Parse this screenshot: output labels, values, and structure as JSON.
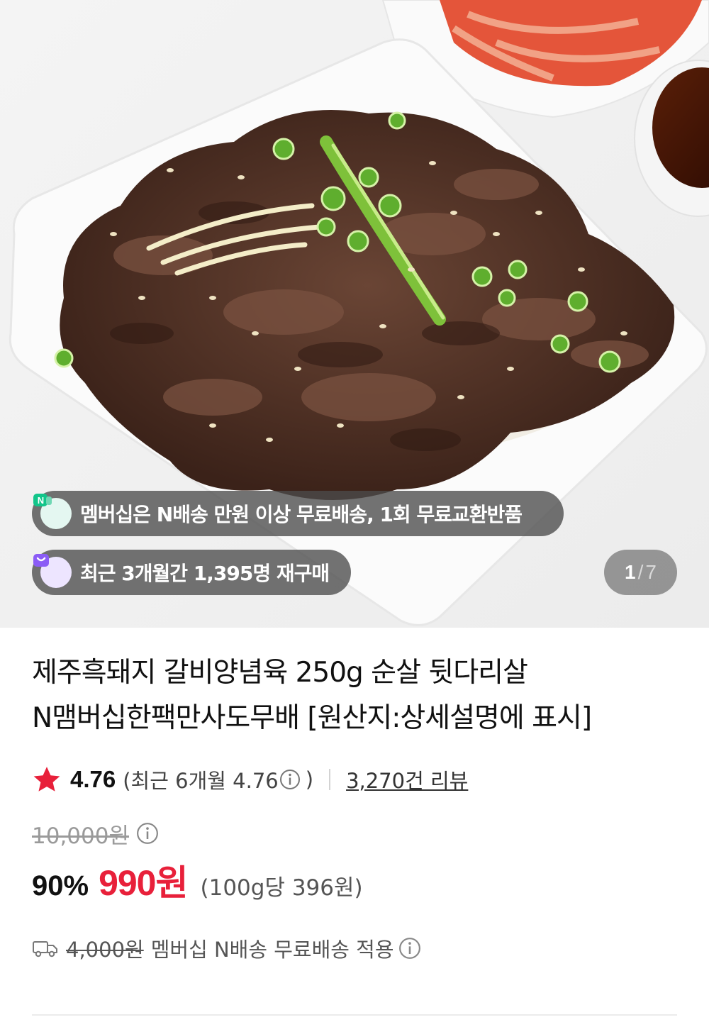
{
  "hero": {
    "benefit_badge": "멤버십은 N배송 만원 이상 무료배송, 1회 무료교환반품",
    "benefit_icon": "N",
    "repurchase_badge": "최근 3개월간 1,395명 재구매",
    "image_counter": {
      "current": "1",
      "separator": "/",
      "total": "7"
    }
  },
  "product": {
    "title_line1": "제주흑돼지 갈비양념육 250g 순살 뒷다리살",
    "title_line2": "N맴버십한팩만사도무배 [원산지:상세설명에 표시]"
  },
  "rating": {
    "score": "4.76",
    "recent_prefix": "(최근 6개월 4.76",
    "recent_suffix": ")",
    "reviews": "3,270건 리뷰"
  },
  "price": {
    "original": "10,000원",
    "discount": "90%",
    "sale": "990원",
    "unit_price": "(100g당 396원)",
    "sale_color": "#e8203a"
  },
  "shipping": {
    "original_fee": "4,000원",
    "text": "멤버십 N배송 무료배송 적용"
  },
  "icons": [
    "n-delivery-icon",
    "shopping-bag-icon",
    "star-icon",
    "info-icon",
    "truck-icon"
  ]
}
